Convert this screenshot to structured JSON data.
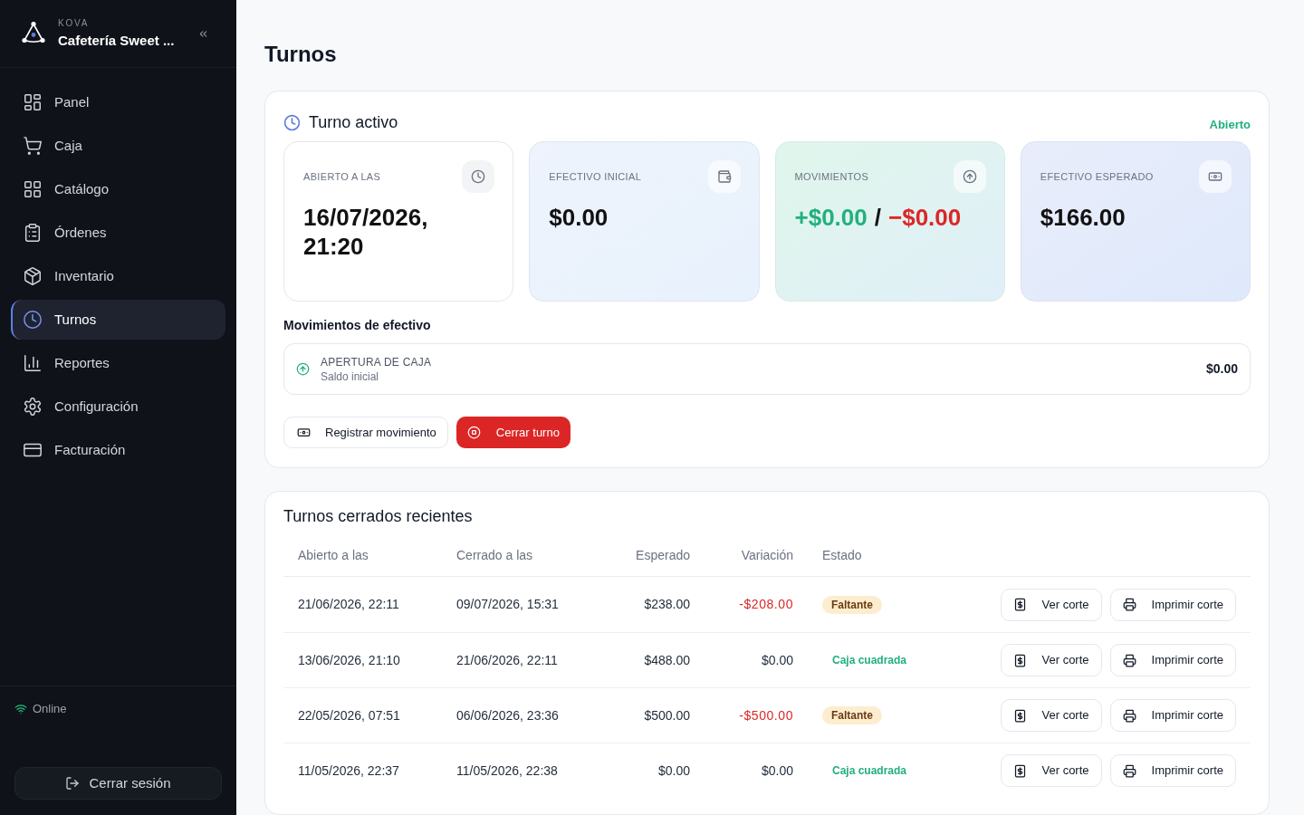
{
  "sidebar": {
    "brand": {
      "kicker": "KOVA",
      "name": "Cafetería Sweet ..."
    },
    "nav": [
      {
        "label": "Panel",
        "selected": false
      },
      {
        "label": "Caja",
        "selected": false
      },
      {
        "label": "Catálogo",
        "selected": false
      },
      {
        "label": "Órdenes",
        "selected": false
      },
      {
        "label": "Inventario",
        "selected": false
      },
      {
        "label": "Turnos",
        "selected": true
      },
      {
        "label": "Reportes",
        "selected": false
      },
      {
        "label": "Configuración",
        "selected": false
      },
      {
        "label": "Facturación",
        "selected": false
      }
    ],
    "connection": {
      "label": "Online",
      "online": true
    },
    "logout": "Cerrar sesión"
  },
  "page": {
    "title": "Turnos"
  },
  "active_shift": {
    "title": "Turno activo",
    "status": "Abierto",
    "stats": [
      {
        "kind": "single",
        "label": "ABIERTO A LAS",
        "value": "16/07/2026, 21:20"
      },
      {
        "kind": "single",
        "label": "EFECTIVO INICIAL",
        "value": "$0.00"
      },
      {
        "kind": "split",
        "label": "MOVIMIENTOS",
        "income": "+$0.00",
        "separator": "/",
        "expense": "−$0.00"
      },
      {
        "kind": "single",
        "label": "EFECTIVO ESPERADO",
        "value": "$166.00"
      }
    ],
    "movements_title": "Movimientos de efectivo",
    "movements": [
      {
        "kind": "income",
        "title": "APERTURA DE CAJA",
        "subtitle": "Saldo inicial",
        "amount": "$0.00"
      }
    ],
    "buttons": [
      {
        "kind": "secondary",
        "label": "Registrar movimiento"
      },
      {
        "kind": "danger",
        "label": "Cerrar turno"
      }
    ]
  },
  "closed_shifts": {
    "title": "Turnos cerrados recientes",
    "columns": [
      "Abierto a las",
      "Cerrado a las",
      "Esperado",
      "Variación",
      "Estado"
    ],
    "rows": [
      {
        "opened": "21/06/2026, 22:11",
        "closed": "09/07/2026, 15:31",
        "expected": "$238.00",
        "variance": "-$208.00",
        "variance_negative": true,
        "status": {
          "kind": "shortage",
          "label": "Faltante"
        },
        "actions": [
          {
            "kind": "view",
            "label": "Ver corte"
          },
          {
            "kind": "print",
            "label": "Imprimir corte"
          }
        ]
      },
      {
        "opened": "13/06/2026, 21:10",
        "closed": "21/06/2026, 22:11",
        "expected": "$488.00",
        "variance": "$0.00",
        "variance_negative": false,
        "status": {
          "kind": "balanced",
          "label": "Caja cuadrada"
        },
        "actions": [
          {
            "kind": "view",
            "label": "Ver corte"
          },
          {
            "kind": "print",
            "label": "Imprimir corte"
          }
        ]
      },
      {
        "opened": "22/05/2026, 07:51",
        "closed": "06/06/2026, 23:36",
        "expected": "$500.00",
        "variance": "-$500.00",
        "variance_negative": true,
        "status": {
          "kind": "shortage",
          "label": "Faltante"
        },
        "actions": [
          {
            "kind": "view",
            "label": "Ver corte"
          },
          {
            "kind": "print",
            "label": "Imprimir corte"
          }
        ]
      },
      {
        "opened": "11/05/2026, 22:37",
        "closed": "11/05/2026, 22:38",
        "expected": "$0.00",
        "variance": "$0.00",
        "variance_negative": false,
        "status": {
          "kind": "balanced",
          "label": "Caja cuadrada"
        },
        "actions": [
          {
            "kind": "view",
            "label": "Ver corte"
          },
          {
            "kind": "print",
            "label": "Imprimir corte"
          }
        ]
      }
    ]
  }
}
